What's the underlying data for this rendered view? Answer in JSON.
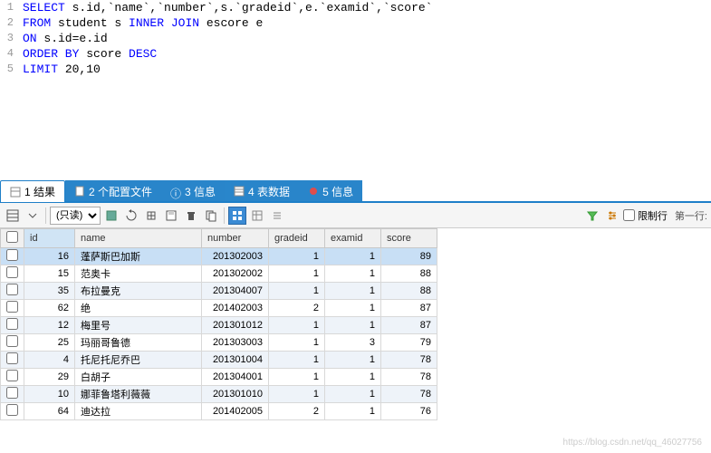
{
  "sql": {
    "lines": [
      {
        "n": "1",
        "tokens": [
          {
            "t": "SELECT ",
            "c": "kw"
          },
          {
            "t": "s.id,`name`,`number`,s.`gradeid`,e.`examid`,`score`",
            "c": "plain"
          }
        ]
      },
      {
        "n": "2",
        "tokens": [
          {
            "t": "FROM ",
            "c": "kw"
          },
          {
            "t": "student s ",
            "c": "plain"
          },
          {
            "t": "INNER JOIN ",
            "c": "kw"
          },
          {
            "t": "escore e",
            "c": "plain"
          }
        ]
      },
      {
        "n": "3",
        "tokens": [
          {
            "t": "ON ",
            "c": "kw"
          },
          {
            "t": "s.id=e.id",
            "c": "plain"
          }
        ]
      },
      {
        "n": "4",
        "tokens": [
          {
            "t": "ORDER BY ",
            "c": "kw"
          },
          {
            "t": "score ",
            "c": "plain"
          },
          {
            "t": "DESC",
            "c": "kw"
          }
        ]
      },
      {
        "n": "5",
        "tokens": [
          {
            "t": "LIMIT ",
            "c": "kw"
          },
          {
            "t": "20,10",
            "c": "plain"
          }
        ]
      }
    ]
  },
  "tabs": [
    {
      "label": "1 结果",
      "active": true
    },
    {
      "label": "2 个配置文件",
      "active": false
    },
    {
      "label": "3 信息",
      "active": false,
      "prefix": "ⓘ"
    },
    {
      "label": "4 表数据",
      "active": false
    },
    {
      "label": "5 信息",
      "active": false
    }
  ],
  "toolbar": {
    "readonly_label": "(只读)",
    "limit_label": "限制行",
    "firstrow_label": "第一行:"
  },
  "columns": [
    "id",
    "name",
    "number",
    "gradeid",
    "examid",
    "score"
  ],
  "sorted_col": "id",
  "rows": [
    {
      "id": 16,
      "name": "蓬萨斯巴加斯",
      "number": "201302003",
      "gradeid": 1,
      "examid": 1,
      "score": 89,
      "sel": true
    },
    {
      "id": 15,
      "name": "范奥卡",
      "number": "201302002",
      "gradeid": 1,
      "examid": 1,
      "score": 88
    },
    {
      "id": 35,
      "name": "布拉曼克",
      "number": "201304007",
      "gradeid": 1,
      "examid": 1,
      "score": 88,
      "alt": true
    },
    {
      "id": 62,
      "name": "绝",
      "number": "201402003",
      "gradeid": 2,
      "examid": 1,
      "score": 87
    },
    {
      "id": 12,
      "name": "梅里号",
      "number": "201301012",
      "gradeid": 1,
      "examid": 1,
      "score": 87,
      "alt": true
    },
    {
      "id": 25,
      "name": "玛丽哥鲁德",
      "number": "201303003",
      "gradeid": 1,
      "examid": 3,
      "score": 79
    },
    {
      "id": 4,
      "name": "托尼托尼乔巴",
      "number": "201301004",
      "gradeid": 1,
      "examid": 1,
      "score": 78,
      "alt": true
    },
    {
      "id": 29,
      "name": "白胡子",
      "number": "201304001",
      "gradeid": 1,
      "examid": 1,
      "score": 78
    },
    {
      "id": 10,
      "name": "娜菲鲁塔利薇薇",
      "number": "201301010",
      "gradeid": 1,
      "examid": 1,
      "score": 78,
      "alt": true
    },
    {
      "id": 64,
      "name": "迪达拉",
      "number": "201402005",
      "gradeid": 2,
      "examid": 1,
      "score": 76
    }
  ],
  "watermark": "https://blog.csdn.net/qq_46027756"
}
